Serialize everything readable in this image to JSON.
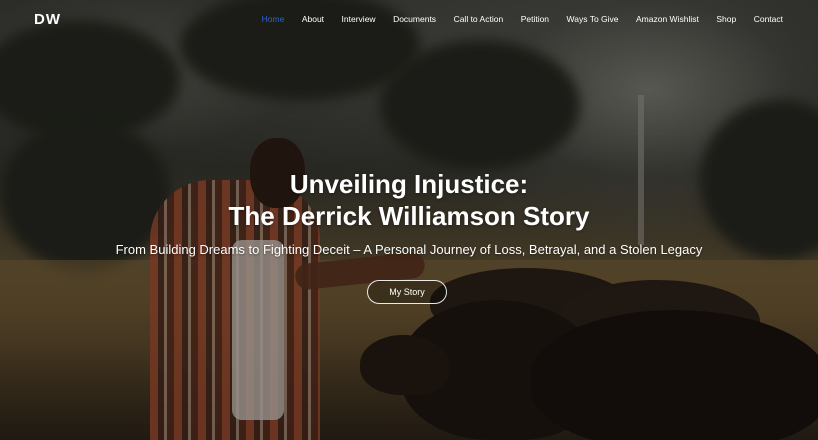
{
  "header": {
    "logo": "DW",
    "nav": [
      {
        "label": "Home",
        "active": true
      },
      {
        "label": "About",
        "active": false
      },
      {
        "label": "Interview",
        "active": false
      },
      {
        "label": "Documents",
        "active": false
      },
      {
        "label": "Call to Action",
        "active": false
      },
      {
        "label": "Petition",
        "active": false
      },
      {
        "label": "Ways To Give",
        "active": false
      },
      {
        "label": "Amazon Wishlist",
        "active": false
      },
      {
        "label": "Shop",
        "active": false
      },
      {
        "label": "Contact",
        "active": false
      }
    ]
  },
  "hero": {
    "title_line1": "Unveiling Injustice:",
    "title_line2": "The Derrick Williamson Story",
    "subtitle": "From Building Dreams to Fighting Deceit – A Personal Journey of Loss, Betrayal, and a Stolen Legacy",
    "cta_label": "My Story",
    "background": "photo-man-with-cattle"
  },
  "colors": {
    "active_nav": "#2f63c8",
    "text": "#ffffff"
  }
}
